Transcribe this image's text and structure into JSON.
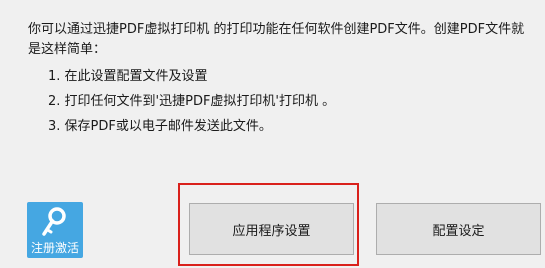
{
  "intro": {
    "text": "你可以通过迅捷PDF虚拟打印机 的打印功能在任何软件创建PDF文件。创建PDF文件就是这样简单："
  },
  "steps": [
    "1. 在此设置配置文件及设置",
    "2. 打印任何文件到'迅捷PDF虚拟打印机'打印机 。",
    "3. 保存PDF或以电子邮件发送此文件。"
  ],
  "register": {
    "label": "注册激活",
    "icon": "key-icon",
    "tile_color": "#45a7e2"
  },
  "buttons": {
    "app_settings": "应用程序设置",
    "profile_settings": "配置设定"
  },
  "colors": {
    "highlight_border": "#d9201b",
    "background": "#f0f0f0"
  }
}
